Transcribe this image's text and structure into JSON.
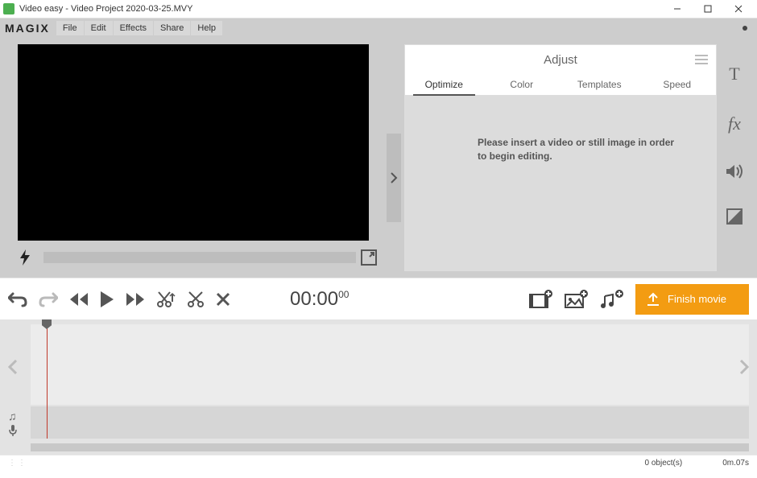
{
  "titlebar": {
    "title": "Video easy - Video Project 2020-03-25.MVY"
  },
  "brand": "MAGIX",
  "menu": {
    "file": "File",
    "edit": "Edit",
    "effects": "Effects",
    "share": "Share",
    "help": "Help"
  },
  "adjust": {
    "title": "Adjust",
    "tabs": {
      "optimize": "Optimize",
      "color": "Color",
      "templates": "Templates",
      "speed": "Speed"
    },
    "message": "Please insert a video or still image in order to begin editing."
  },
  "timecode": {
    "main": "00:00",
    "frac": "00"
  },
  "finish": "Finish movie",
  "status": {
    "objects": "0 object(s)",
    "duration": "0m.07s"
  }
}
